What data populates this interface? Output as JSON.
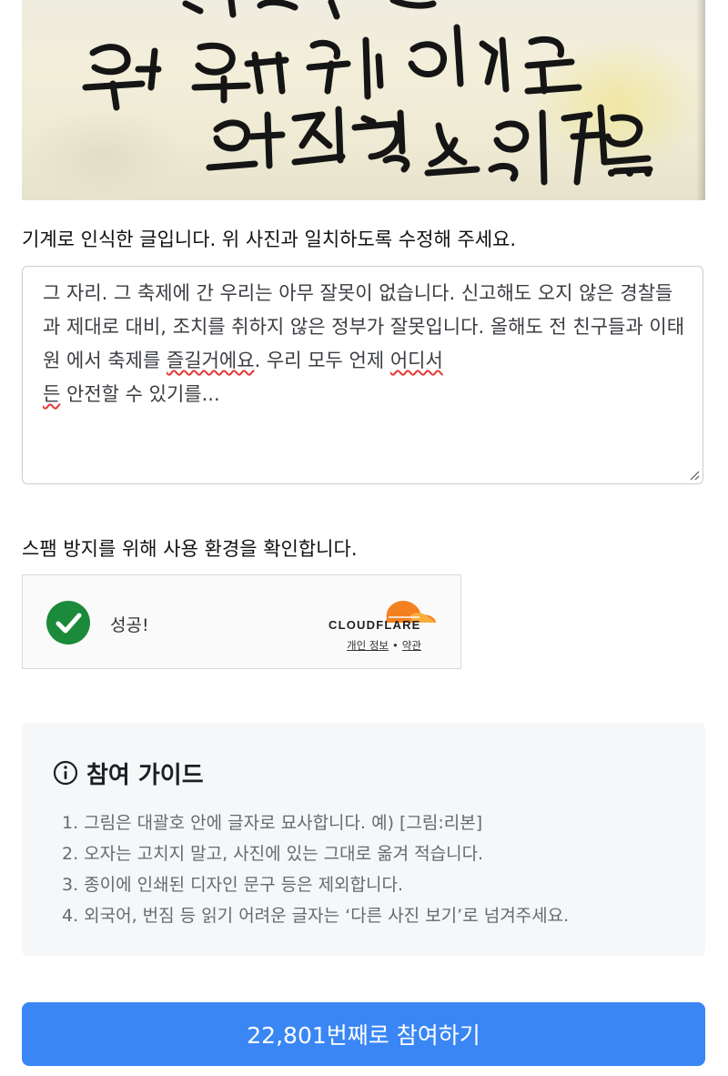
{
  "photo": {
    "handwritten_lines": [
      "우리 모두 언제 어디서든",
      "안전할 수 있기를..."
    ]
  },
  "prompt": {
    "text": "기계로 인식한 글입니다. 위 사진과 일치하도록 수정해 주세요."
  },
  "transcription": {
    "part1": "그 자리. 그 축제에 간 우리는 아무 잘못이 없습니다. 신고해도 오지 않은 경찰들과 제대로 대비, 조치를 취하지 않은 정부가 잘못입니다. 올해도 전 친구들과 이태원 에서 축제를 ",
    "flag1": "즐길거에요",
    "part2": ". 우리 모두 언제 ",
    "flag2a": "어디서",
    "flag2b": "든",
    "part3": " 안전할 수 있기를..."
  },
  "spam_check": {
    "label": "스팸 방지를 위해 사용 환경을 확인합니다.",
    "status": "성공!",
    "provider": "CLOUDFLARE",
    "privacy_link": "개인 정보",
    "separator": "•",
    "terms_link": "약관",
    "accent_color": "#f48120",
    "success_color": "#1b8a3a"
  },
  "guide": {
    "icon": "info-circle-icon",
    "title": "참여 가이드",
    "items": [
      "1. 그림은 대괄호 안에 글자로 묘사합니다. 예) [그림:리본]",
      "2. 오자는 고치지 말고, 사진에 있는 그대로 옮겨 적습니다.",
      "3. 종이에 인쇄된 디자인 문구 등은 제외합니다.",
      "4. 외국어, 번짐 등 읽기 어려운 글자는 ‘다른 사진 보기’로 넘겨주세요."
    ]
  },
  "cta": {
    "label": "22,801번째로 참여하기",
    "color": "#3a86f5"
  }
}
